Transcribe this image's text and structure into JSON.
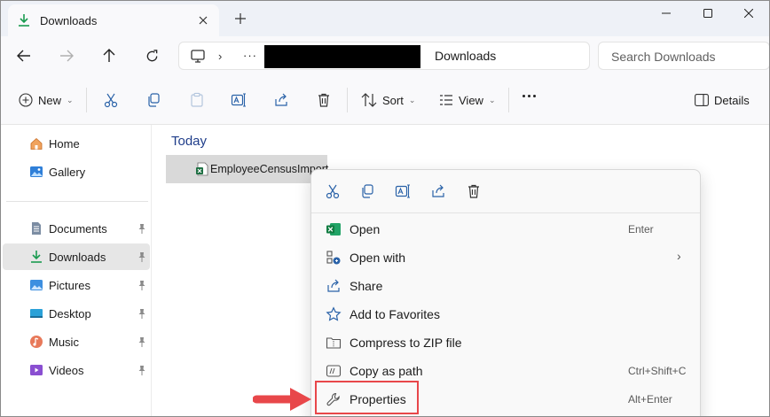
{
  "window": {
    "tab_title": "Downloads",
    "new_tab_symbol": "+"
  },
  "address": {
    "current_folder": "Downloads",
    "overflow": "···",
    "search_placeholder": "Search Downloads"
  },
  "toolbar": {
    "new_label": "New",
    "sort_label": "Sort",
    "view_label": "View",
    "details_label": "Details"
  },
  "sidebar": {
    "items": [
      {
        "label": "Home",
        "icon": "home-icon",
        "pinned": false
      },
      {
        "label": "Gallery",
        "icon": "gallery-icon",
        "pinned": false
      },
      {
        "label": "Documents",
        "icon": "documents-icon",
        "pinned": true
      },
      {
        "label": "Downloads",
        "icon": "downloads-icon",
        "pinned": true,
        "selected": true
      },
      {
        "label": "Pictures",
        "icon": "pictures-icon",
        "pinned": true
      },
      {
        "label": "Desktop",
        "icon": "desktop-icon",
        "pinned": true
      },
      {
        "label": "Music",
        "icon": "music-icon",
        "pinned": true
      },
      {
        "label": "Videos",
        "icon": "videos-icon",
        "pinned": true
      }
    ]
  },
  "content": {
    "group_header": "Today",
    "file_name": "EmployeeCensusImport"
  },
  "context_menu": {
    "items": [
      {
        "label": "Open",
        "shortcut": "Enter",
        "icon": "excel-icon"
      },
      {
        "label": "Open with",
        "shortcut": "",
        "icon": "open-with-icon",
        "submenu": true
      },
      {
        "label": "Share",
        "shortcut": "",
        "icon": "share-icon"
      },
      {
        "label": "Add to Favorites",
        "shortcut": "",
        "icon": "star-icon"
      },
      {
        "label": "Compress to ZIP file",
        "shortcut": "",
        "icon": "zip-icon"
      },
      {
        "label": "Copy as path",
        "shortcut": "Ctrl+Shift+C",
        "icon": "copy-path-icon"
      },
      {
        "label": "Properties",
        "shortcut": "Alt+Enter",
        "icon": "wrench-icon",
        "highlighted": true
      }
    ],
    "submenu_arrow": "›"
  },
  "colors": {
    "accent": "#1a7f37",
    "highlight_border": "#e8474a",
    "excel_green": "#1d6f42",
    "link_blue": "#1f3d8a"
  }
}
